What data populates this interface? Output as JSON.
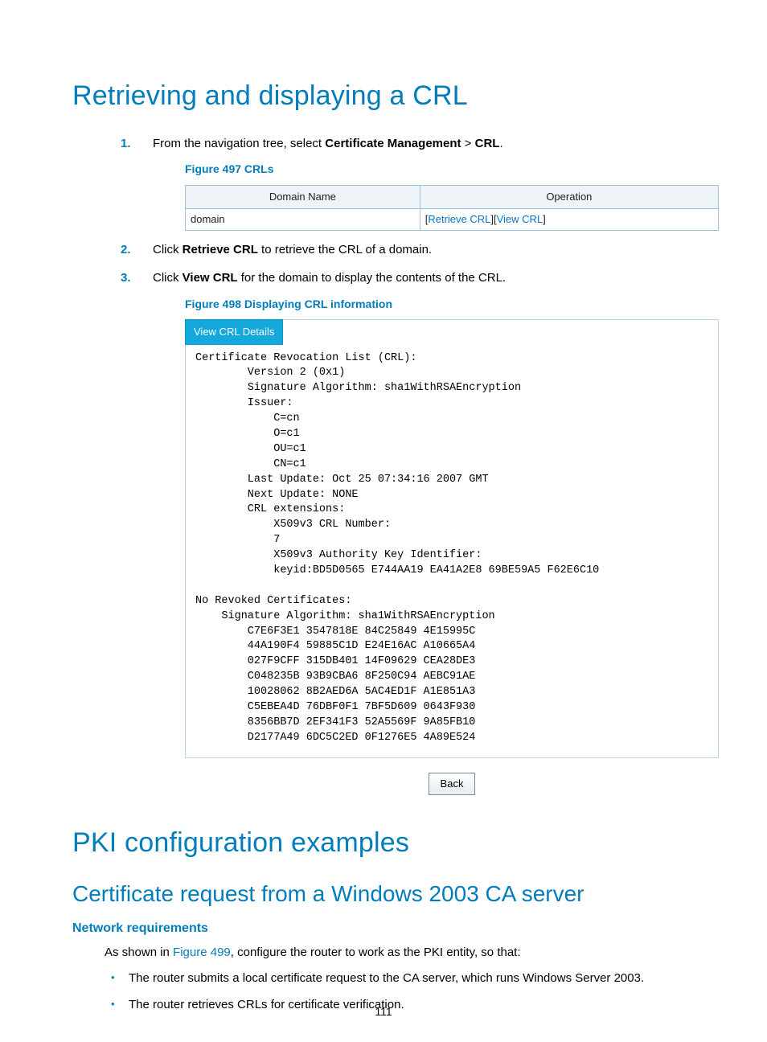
{
  "heading1": "Retrieving and displaying a CRL",
  "step1_pre": "From the navigation tree, select ",
  "step1_b1": "Certificate Management",
  "step1_mid": " > ",
  "step1_b2": "CRL",
  "step1_post": ".",
  "fig497_caption": "Figure 497 CRLs",
  "table": {
    "h1": "Domain Name",
    "h2": "Operation",
    "row1_domain": "domain",
    "row1_op_l1": "Retrieve CRL",
    "row1_op_l2": "View CRL"
  },
  "step2_pre": "Click ",
  "step2_b": "Retrieve CRL",
  "step2_post": " to retrieve the CRL of a domain.",
  "step3_pre": "Click ",
  "step3_b": "View CRL",
  "step3_post": " for the domain to display the contents of the CRL.",
  "fig498_caption": "Figure 498 Displaying CRL information",
  "crl_tab": "View CRL Details",
  "crl_text": "Certificate Revocation List (CRL):\n        Version 2 (0x1)\n        Signature Algorithm: sha1WithRSAEncryption\n        Issuer:\n            C=cn\n            O=c1\n            OU=c1\n            CN=c1\n        Last Update: Oct 25 07:34:16 2007 GMT\n        Next Update: NONE\n        CRL extensions:\n            X509v3 CRL Number:\n            7\n            X509v3 Authority Key Identifier:\n            keyid:BD5D0565 E744AA19 EA41A2E8 69BE59A5 F62E6C10\n\nNo Revoked Certificates:\n    Signature Algorithm: sha1WithRSAEncryption\n        C7E6F3E1 3547818E 84C25849 4E15995C\n        44A190F4 59885C1D E24E16AC A10665A4\n        027F9CFF 315DB401 14F09629 CEA28DE3\n        C048235B 93B9CBA6 8F250C94 AEBC91AE\n        10028062 8B2AED6A 5AC4ED1F A1E851A3\n        C5EBEA4D 76DBF0F1 7BF5D609 0643F930\n        8356BB7D 2EF341F3 52A5569F 9A85FB10\n        D2177A49 6DC5C2ED 0F1276E5 4A89E524",
  "back_label": "Back",
  "heading2": "PKI configuration examples",
  "heading3": "Certificate request from a Windows 2003 CA server",
  "netreq_heading": "Network requirements",
  "netreq_intro_pre": "As shown in ",
  "netreq_intro_link": "Figure 499",
  "netreq_intro_post": ", configure the router to work as the PKI entity, so that:",
  "bullet1": "The router submits a local certificate request to the CA server, which runs Windows Server 2003.",
  "bullet2": "The router retrieves CRLs for certificate verification.",
  "page_number": "111"
}
